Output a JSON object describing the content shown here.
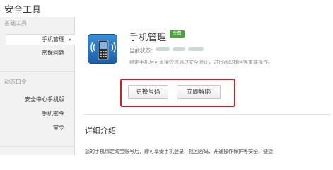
{
  "page": {
    "title": "安全工具"
  },
  "sidebar": {
    "sections": [
      {
        "title": "基础工具",
        "items": [
          {
            "label": "手机管理",
            "active": true
          },
          {
            "label": "密保问题",
            "active": false
          }
        ]
      },
      {
        "title": "动态口令",
        "items": [
          {
            "label": "安全中心手机版",
            "active": false
          },
          {
            "label": "手机密令",
            "active": false
          },
          {
            "label": "宝令",
            "active": false
          }
        ]
      }
    ]
  },
  "card": {
    "icon": "mobile-phone-icon",
    "title": "手机管理",
    "badge": "免费",
    "status_label": "当前状态：",
    "status_value": "(blurred)",
    "description": "绑定手机后可直接短信通过安全验证，进行密码找回等重要操作。",
    "buttons": {
      "change": "更换号码",
      "unbind": "立即解绑"
    },
    "highlight_color": "#b52a2f"
  },
  "details": {
    "title": "详细介绍",
    "text": "您的手机绑定淘宝账号后，即可享受手机登录、找回密码、开通操作保护等安全、便捷"
  }
}
